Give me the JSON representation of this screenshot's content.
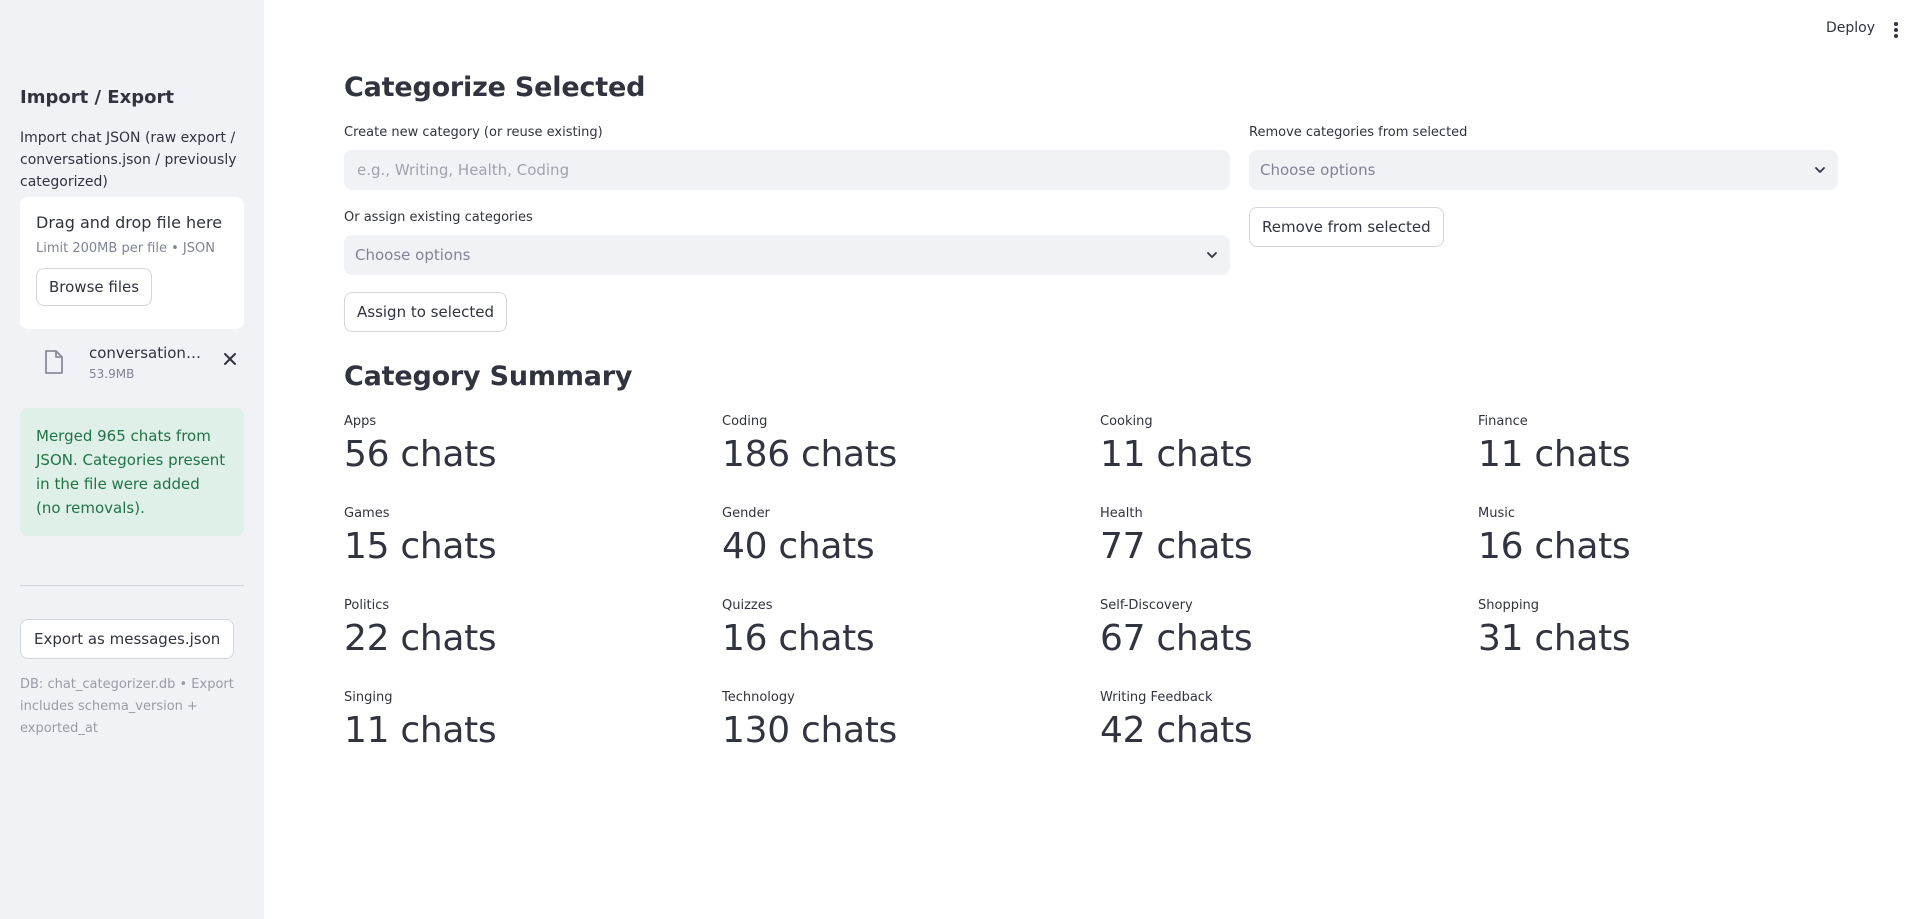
{
  "sidebar": {
    "heading": "Import / Export",
    "upload_label": "Import chat JSON (raw export / conversations.json / previously categorized)",
    "dropzone": {
      "title": "Drag and drop file here",
      "limit": "Limit 200MB per file • JSON",
      "browse_label": "Browse files"
    },
    "file": {
      "name": "conversations.json",
      "size": "53.9MB",
      "icon": "file-icon"
    },
    "success_message": "Merged 965 chats from JSON. Categories present in the file were added (no removals).",
    "export_label": "Export as messages.json",
    "caption": "DB: chat_categorizer.db • Export includes schema_version + exported_at"
  },
  "header": {
    "deploy_label": "Deploy"
  },
  "categorize": {
    "title": "Categorize Selected",
    "new_category_label": "Create new category (or reuse existing)",
    "new_category_placeholder": "e.g., Writing, Health, Coding",
    "remove_label": "Remove categories from selected",
    "remove_placeholder": "Choose options",
    "remove_button": "Remove from selected",
    "assign_label": "Or assign existing categories",
    "assign_placeholder": "Choose options",
    "assign_button": "Assign to selected"
  },
  "summary": {
    "title": "Category Summary",
    "items": [
      {
        "label": "Apps",
        "value": "56 chats"
      },
      {
        "label": "Coding",
        "value": "186 chats"
      },
      {
        "label": "Cooking",
        "value": "11 chats"
      },
      {
        "label": "Finance",
        "value": "11 chats"
      },
      {
        "label": "Games",
        "value": "15 chats"
      },
      {
        "label": "Gender",
        "value": "40 chats"
      },
      {
        "label": "Health",
        "value": "77 chats"
      },
      {
        "label": "Music",
        "value": "16 chats"
      },
      {
        "label": "Politics",
        "value": "22 chats"
      },
      {
        "label": "Quizzes",
        "value": "16 chats"
      },
      {
        "label": "Self-Discovery",
        "value": "67 chats"
      },
      {
        "label": "Shopping",
        "value": "31 chats"
      },
      {
        "label": "Singing",
        "value": "11 chats"
      },
      {
        "label": "Technology",
        "value": "130 chats"
      },
      {
        "label": "Writing Feedback",
        "value": "42 chats"
      }
    ]
  },
  "colors": {
    "sidebar_bg": "#f0f2f6",
    "success_bg": "#dff0e8",
    "success_text": "#217346",
    "text": "#31333f"
  }
}
